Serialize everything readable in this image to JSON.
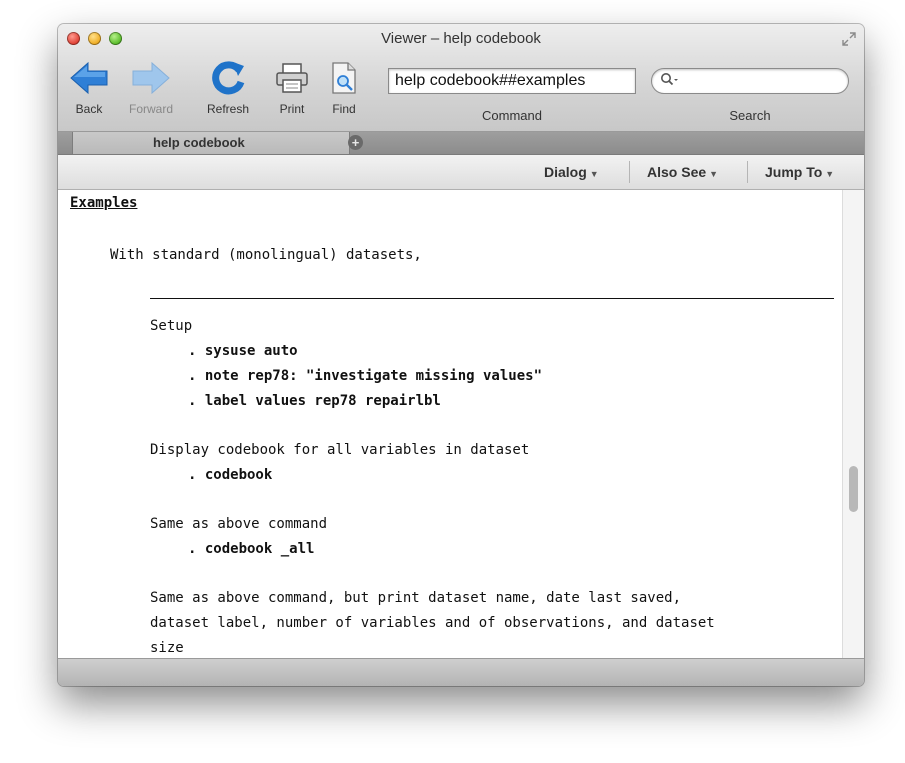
{
  "window": {
    "title": "Viewer – help codebook"
  },
  "toolbar": {
    "back_label": "Back",
    "forward_label": "Forward",
    "refresh_label": "Refresh",
    "print_label": "Print",
    "find_label": "Find",
    "command_value": "help codebook##examples",
    "command_label": "Command",
    "search_label": "Search",
    "search_placeholder": ""
  },
  "tabs": [
    {
      "label": "help codebook"
    }
  ],
  "menus": {
    "dialog": "Dialog",
    "also_see": "Also See",
    "jump_to": "Jump To"
  },
  "content": {
    "heading": "Examples",
    "intro": "With standard (monolingual) datasets,",
    "setup_label": "Setup",
    "cmd1": ". sysuse auto",
    "cmd2": ". note rep78: \"investigate missing values\"",
    "cmd3": ". label values rep78 repairlbl",
    "desc2": "Display codebook for all variables in dataset",
    "cmd4": ". codebook",
    "desc3": "Same as above command",
    "cmd5": ". codebook _all",
    "desc4_line1": "Same as above command, but print dataset name, date last saved,",
    "desc4_line2": "dataset label, number of variables and of observations, and dataset",
    "desc4_line3": "size"
  },
  "icons": {
    "back": "back-arrow-icon",
    "forward": "forward-arrow-icon",
    "refresh": "refresh-icon",
    "print": "printer-icon",
    "find": "find-document-icon",
    "search": "magnifier-icon",
    "add_tab": "plus-icon"
  },
  "colors": {
    "arrow_blue": "#2f7fd6",
    "arrow_disabled": "#8ab8e6",
    "refresh_blue": "#1f73c9"
  }
}
